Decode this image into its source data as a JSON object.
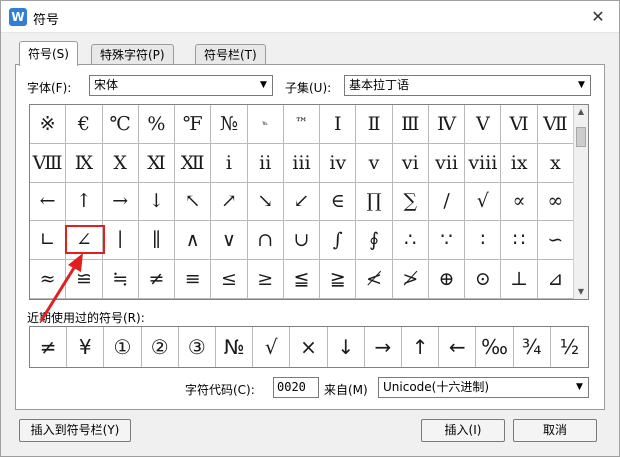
{
  "window": {
    "title": "符号",
    "app_icon_glyph": "W"
  },
  "tabs": [
    {
      "label": "符号(S)",
      "active": true
    },
    {
      "label": "特殊字符(P)",
      "active": false
    },
    {
      "label": "符号栏(T)",
      "active": false
    }
  ],
  "font_row": {
    "label": "字体(F):",
    "value": "宋体"
  },
  "subset_row": {
    "label": "子集(U):",
    "value": "基本拉丁语"
  },
  "symbols": [
    [
      "※",
      "€",
      "℃",
      "%",
      "℉",
      "№",
      "℡",
      "™",
      "Ⅰ",
      "Ⅱ",
      "Ⅲ",
      "Ⅳ",
      "Ⅴ",
      "Ⅵ",
      "Ⅶ"
    ],
    [
      "Ⅷ",
      "Ⅸ",
      "Ⅹ",
      "Ⅺ",
      "Ⅻ",
      "ⅰ",
      "ⅱ",
      "ⅲ",
      "ⅳ",
      "ⅴ",
      "ⅵ",
      "ⅶ",
      "ⅷ",
      "ⅸ",
      "ⅹ"
    ],
    [
      "←",
      "↑",
      "→",
      "↓",
      "↖",
      "↗",
      "↘",
      "↙",
      "∈",
      "∏",
      "∑",
      "∕",
      "√",
      "∝",
      "∞"
    ],
    [
      "∟",
      "∠",
      "∣",
      "∥",
      "∧",
      "∨",
      "∩",
      "∪",
      "∫",
      "∮",
      "∴",
      "∵",
      "∶",
      "∷",
      "∽"
    ],
    [
      "≈",
      "≌",
      "≒",
      "≠",
      "≡",
      "≤",
      "≥",
      "≦",
      "≧",
      "≮",
      "≯",
      "⊕",
      "⊙",
      "⊥",
      "⊿"
    ]
  ],
  "recent_label": "近期使用过的符号(R):",
  "recent_symbols": [
    "≠",
    "¥",
    "①",
    "②",
    "③",
    "№",
    "√",
    "×",
    "↓",
    "→",
    "↑",
    "←",
    "‰",
    "¾",
    "½"
  ],
  "char_code": {
    "label": "字符代码(C):",
    "value": "0020"
  },
  "from": {
    "label": "来自(M)",
    "value": "Unicode(十六进制)"
  },
  "buttons": {
    "insert_to_bar": "插入到符号栏(Y)",
    "insert": "插入(I)",
    "cancel": "取消"
  },
  "accent_color": "#e02020"
}
